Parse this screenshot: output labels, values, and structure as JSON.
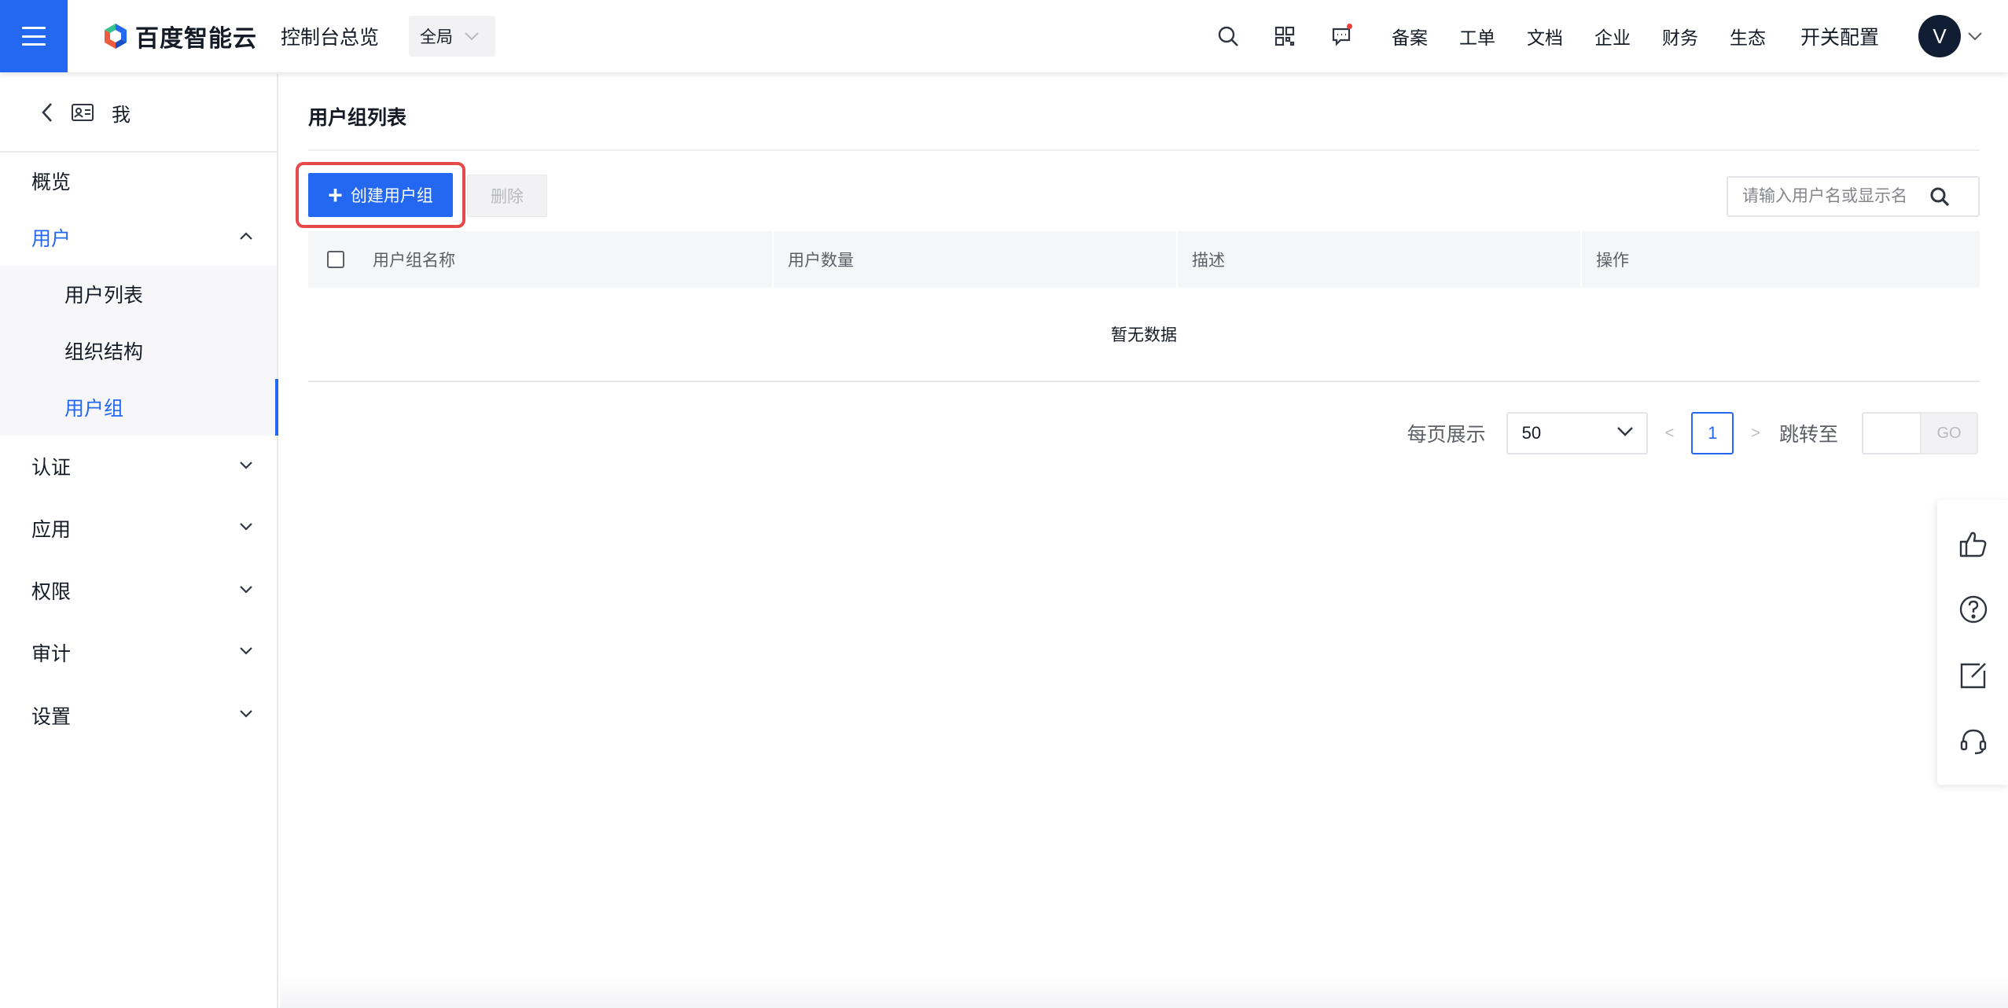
{
  "header": {
    "logo_text": "百度智能云",
    "console_title": "控制台总览",
    "region": "全局",
    "links": [
      "备案",
      "工单",
      "文档",
      "企业",
      "财务",
      "生态"
    ],
    "switch_config": "开关配置",
    "avatar_letter": "V",
    "brand_color": "#2468f2"
  },
  "sidebar": {
    "header_label": "我",
    "items": [
      {
        "label": "概览"
      },
      {
        "label": "用户",
        "expanded": true
      },
      {
        "label": "认证"
      },
      {
        "label": "应用"
      },
      {
        "label": "权限"
      },
      {
        "label": "审计"
      },
      {
        "label": "设置"
      }
    ],
    "user_sub_items": [
      {
        "label": "用户列表"
      },
      {
        "label": "组织结构"
      },
      {
        "label": "用户组",
        "active": true
      }
    ]
  },
  "main": {
    "page_title": "用户组列表",
    "create_button": "创建用户组",
    "delete_button": "删除",
    "search_placeholder": "请输入用户名或显示名",
    "table": {
      "columns": [
        "用户组名称",
        "用户数量",
        "描述",
        "操作"
      ],
      "rows": [],
      "empty_text": "暂无数据"
    },
    "pagination": {
      "per_page_label": "每页展示",
      "per_page_value": "50",
      "prev": "<",
      "current_page": "1",
      "next": ">",
      "jump_label": "跳转至",
      "go_label": "GO"
    }
  },
  "float_toolbar": [
    "thumbs-up-icon",
    "help-icon",
    "edit-icon",
    "headset-icon"
  ]
}
